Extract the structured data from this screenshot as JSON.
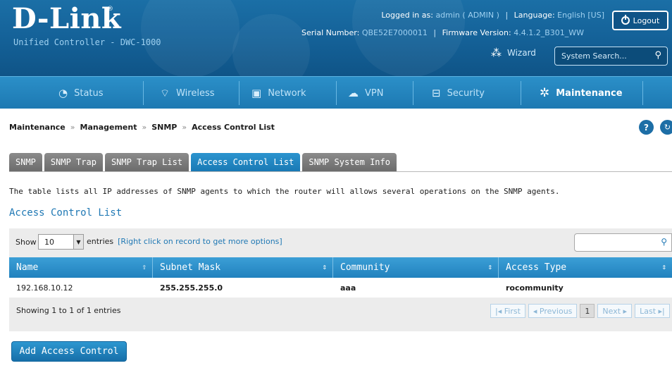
{
  "header": {
    "brand": "D-Link",
    "brand_mark": "®",
    "product": "Unified Controller - DWC-1000",
    "logged_in_label": "Logged in as:",
    "logged_in_value": "admin ( ADMIN )",
    "language_label": "Language:",
    "language_value": "English [US]",
    "logout_label": "Logout",
    "serial_label": "Serial Number:",
    "serial_value": "QBE52E7000011",
    "firmware_label": "Firmware Version:",
    "firmware_value": "4.4.1.2_B301_WW",
    "wizard_label": "Wizard",
    "search_placeholder": "System Search..."
  },
  "nav": {
    "items": [
      {
        "label": "Status",
        "icon": "dashboard-icon"
      },
      {
        "label": "Wireless",
        "icon": "wifi-icon"
      },
      {
        "label": "Network",
        "icon": "monitor-icon"
      },
      {
        "label": "VPN",
        "icon": "cloud-lock-icon"
      },
      {
        "label": "Security",
        "icon": "lock-icon"
      },
      {
        "label": "Maintenance",
        "icon": "gears-icon",
        "active": true
      }
    ]
  },
  "breadcrumb": {
    "items": [
      "Maintenance",
      "Management",
      "SNMP",
      "Access Control List"
    ],
    "separator": "»"
  },
  "tabs": [
    {
      "label": "SNMP"
    },
    {
      "label": "SNMP Trap"
    },
    {
      "label": "SNMP Trap List"
    },
    {
      "label": "Access Control List",
      "active": true
    },
    {
      "label": "SNMP System Info"
    }
  ],
  "description": "The table lists all IP addresses of SNMP agents to which the router will allows several operations on the SNMP agents.",
  "section_title": "Access Control List",
  "table": {
    "show_label": "Show",
    "page_size": "10",
    "entries_label": "entries",
    "hint": "[Right click on record to get more options]",
    "columns": [
      "Name",
      "Subnet Mask",
      "Community",
      "Access Type"
    ],
    "rows": [
      {
        "name": "192.168.10.12",
        "subnet": "255.255.255.0",
        "community": "aaa",
        "access": "rocommunity"
      }
    ],
    "info": "Showing 1 to 1 of 1 entries",
    "pager": {
      "first": "First",
      "previous": "Previous",
      "current": "1",
      "next": "Next",
      "last": "Last"
    }
  },
  "add_button": "Add Access Control",
  "colors": {
    "header": "#15639a",
    "nav": "#2384bf",
    "accent": "#1f78b4",
    "tab_inactive": "#7b7b7b"
  }
}
